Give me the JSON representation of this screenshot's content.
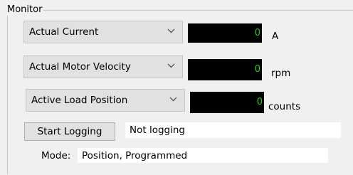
{
  "monitor": {
    "title": "Monitor",
    "rows": [
      {
        "select_value": "Actual Current",
        "readout": "0",
        "unit": "A"
      },
      {
        "select_value": "Actual Motor Velocity",
        "readout": "0",
        "unit": "rpm"
      },
      {
        "select_value": "Active Load Position",
        "readout": "0",
        "unit": "counts"
      }
    ],
    "logging": {
      "button_label": "Start Logging",
      "status": "Not logging"
    },
    "mode": {
      "label": "Mode:",
      "value": "Position, Programmed"
    }
  },
  "colors": {
    "readout_background": "#000000",
    "readout_text": "#2ec82e",
    "combo_background": "#e1e1e1",
    "window_background": "#f0f0f0"
  },
  "icons": {
    "dropdown": "chevron-down-icon"
  }
}
